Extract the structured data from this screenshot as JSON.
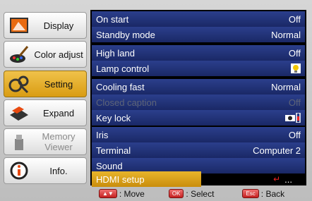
{
  "sidebar": {
    "items": [
      {
        "label": "Display"
      },
      {
        "label": "Color adjust"
      },
      {
        "label": "Setting"
      },
      {
        "label": "Expand"
      },
      {
        "label": "Memory\nViewer"
      },
      {
        "label": "Info."
      }
    ]
  },
  "menu": {
    "rows": [
      {
        "label": "On start",
        "value": "Off"
      },
      {
        "label": "Standby mode",
        "value": "Normal"
      },
      {
        "label": "High land",
        "value": "Off"
      },
      {
        "label": "Lamp control",
        "value": ""
      },
      {
        "label": "Cooling fast",
        "value": "Normal"
      },
      {
        "label": "Closed caption",
        "value": "Off"
      },
      {
        "label": "Key lock",
        "value": ""
      },
      {
        "label": "Iris",
        "value": "Off"
      },
      {
        "label": "Terminal",
        "value": "Computer 2"
      },
      {
        "label": "Sound",
        "value": ""
      },
      {
        "label": "HDMI setup",
        "value": "..."
      }
    ]
  },
  "footer": {
    "move_key": "▲▼",
    "move_label": ": Move",
    "ok_key": "OK",
    "select_label": ": Select",
    "esc_key": "Esc",
    "back_label": ": Back"
  },
  "colors": {
    "accent": "#d99c13",
    "row": "#1a2866",
    "panel": "#000000"
  }
}
